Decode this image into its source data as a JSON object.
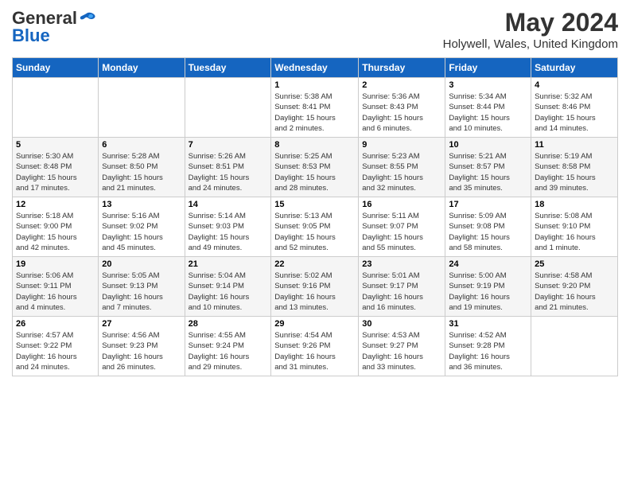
{
  "header": {
    "logo_general": "General",
    "logo_blue": "Blue",
    "month_year": "May 2024",
    "location": "Holywell, Wales, United Kingdom"
  },
  "days_of_week": [
    "Sunday",
    "Monday",
    "Tuesday",
    "Wednesday",
    "Thursday",
    "Friday",
    "Saturday"
  ],
  "weeks": [
    [
      {
        "day": "",
        "info": ""
      },
      {
        "day": "",
        "info": ""
      },
      {
        "day": "",
        "info": ""
      },
      {
        "day": "1",
        "info": "Sunrise: 5:38 AM\nSunset: 8:41 PM\nDaylight: 15 hours\nand 2 minutes."
      },
      {
        "day": "2",
        "info": "Sunrise: 5:36 AM\nSunset: 8:43 PM\nDaylight: 15 hours\nand 6 minutes."
      },
      {
        "day": "3",
        "info": "Sunrise: 5:34 AM\nSunset: 8:44 PM\nDaylight: 15 hours\nand 10 minutes."
      },
      {
        "day": "4",
        "info": "Sunrise: 5:32 AM\nSunset: 8:46 PM\nDaylight: 15 hours\nand 14 minutes."
      }
    ],
    [
      {
        "day": "5",
        "info": "Sunrise: 5:30 AM\nSunset: 8:48 PM\nDaylight: 15 hours\nand 17 minutes."
      },
      {
        "day": "6",
        "info": "Sunrise: 5:28 AM\nSunset: 8:50 PM\nDaylight: 15 hours\nand 21 minutes."
      },
      {
        "day": "7",
        "info": "Sunrise: 5:26 AM\nSunset: 8:51 PM\nDaylight: 15 hours\nand 24 minutes."
      },
      {
        "day": "8",
        "info": "Sunrise: 5:25 AM\nSunset: 8:53 PM\nDaylight: 15 hours\nand 28 minutes."
      },
      {
        "day": "9",
        "info": "Sunrise: 5:23 AM\nSunset: 8:55 PM\nDaylight: 15 hours\nand 32 minutes."
      },
      {
        "day": "10",
        "info": "Sunrise: 5:21 AM\nSunset: 8:57 PM\nDaylight: 15 hours\nand 35 minutes."
      },
      {
        "day": "11",
        "info": "Sunrise: 5:19 AM\nSunset: 8:58 PM\nDaylight: 15 hours\nand 39 minutes."
      }
    ],
    [
      {
        "day": "12",
        "info": "Sunrise: 5:18 AM\nSunset: 9:00 PM\nDaylight: 15 hours\nand 42 minutes."
      },
      {
        "day": "13",
        "info": "Sunrise: 5:16 AM\nSunset: 9:02 PM\nDaylight: 15 hours\nand 45 minutes."
      },
      {
        "day": "14",
        "info": "Sunrise: 5:14 AM\nSunset: 9:03 PM\nDaylight: 15 hours\nand 49 minutes."
      },
      {
        "day": "15",
        "info": "Sunrise: 5:13 AM\nSunset: 9:05 PM\nDaylight: 15 hours\nand 52 minutes."
      },
      {
        "day": "16",
        "info": "Sunrise: 5:11 AM\nSunset: 9:07 PM\nDaylight: 15 hours\nand 55 minutes."
      },
      {
        "day": "17",
        "info": "Sunrise: 5:09 AM\nSunset: 9:08 PM\nDaylight: 15 hours\nand 58 minutes."
      },
      {
        "day": "18",
        "info": "Sunrise: 5:08 AM\nSunset: 9:10 PM\nDaylight: 16 hours\nand 1 minute."
      }
    ],
    [
      {
        "day": "19",
        "info": "Sunrise: 5:06 AM\nSunset: 9:11 PM\nDaylight: 16 hours\nand 4 minutes."
      },
      {
        "day": "20",
        "info": "Sunrise: 5:05 AM\nSunset: 9:13 PM\nDaylight: 16 hours\nand 7 minutes."
      },
      {
        "day": "21",
        "info": "Sunrise: 5:04 AM\nSunset: 9:14 PM\nDaylight: 16 hours\nand 10 minutes."
      },
      {
        "day": "22",
        "info": "Sunrise: 5:02 AM\nSunset: 9:16 PM\nDaylight: 16 hours\nand 13 minutes."
      },
      {
        "day": "23",
        "info": "Sunrise: 5:01 AM\nSunset: 9:17 PM\nDaylight: 16 hours\nand 16 minutes."
      },
      {
        "day": "24",
        "info": "Sunrise: 5:00 AM\nSunset: 9:19 PM\nDaylight: 16 hours\nand 19 minutes."
      },
      {
        "day": "25",
        "info": "Sunrise: 4:58 AM\nSunset: 9:20 PM\nDaylight: 16 hours\nand 21 minutes."
      }
    ],
    [
      {
        "day": "26",
        "info": "Sunrise: 4:57 AM\nSunset: 9:22 PM\nDaylight: 16 hours\nand 24 minutes."
      },
      {
        "day": "27",
        "info": "Sunrise: 4:56 AM\nSunset: 9:23 PM\nDaylight: 16 hours\nand 26 minutes."
      },
      {
        "day": "28",
        "info": "Sunrise: 4:55 AM\nSunset: 9:24 PM\nDaylight: 16 hours\nand 29 minutes."
      },
      {
        "day": "29",
        "info": "Sunrise: 4:54 AM\nSunset: 9:26 PM\nDaylight: 16 hours\nand 31 minutes."
      },
      {
        "day": "30",
        "info": "Sunrise: 4:53 AM\nSunset: 9:27 PM\nDaylight: 16 hours\nand 33 minutes."
      },
      {
        "day": "31",
        "info": "Sunrise: 4:52 AM\nSunset: 9:28 PM\nDaylight: 16 hours\nand 36 minutes."
      },
      {
        "day": "",
        "info": ""
      }
    ]
  ]
}
